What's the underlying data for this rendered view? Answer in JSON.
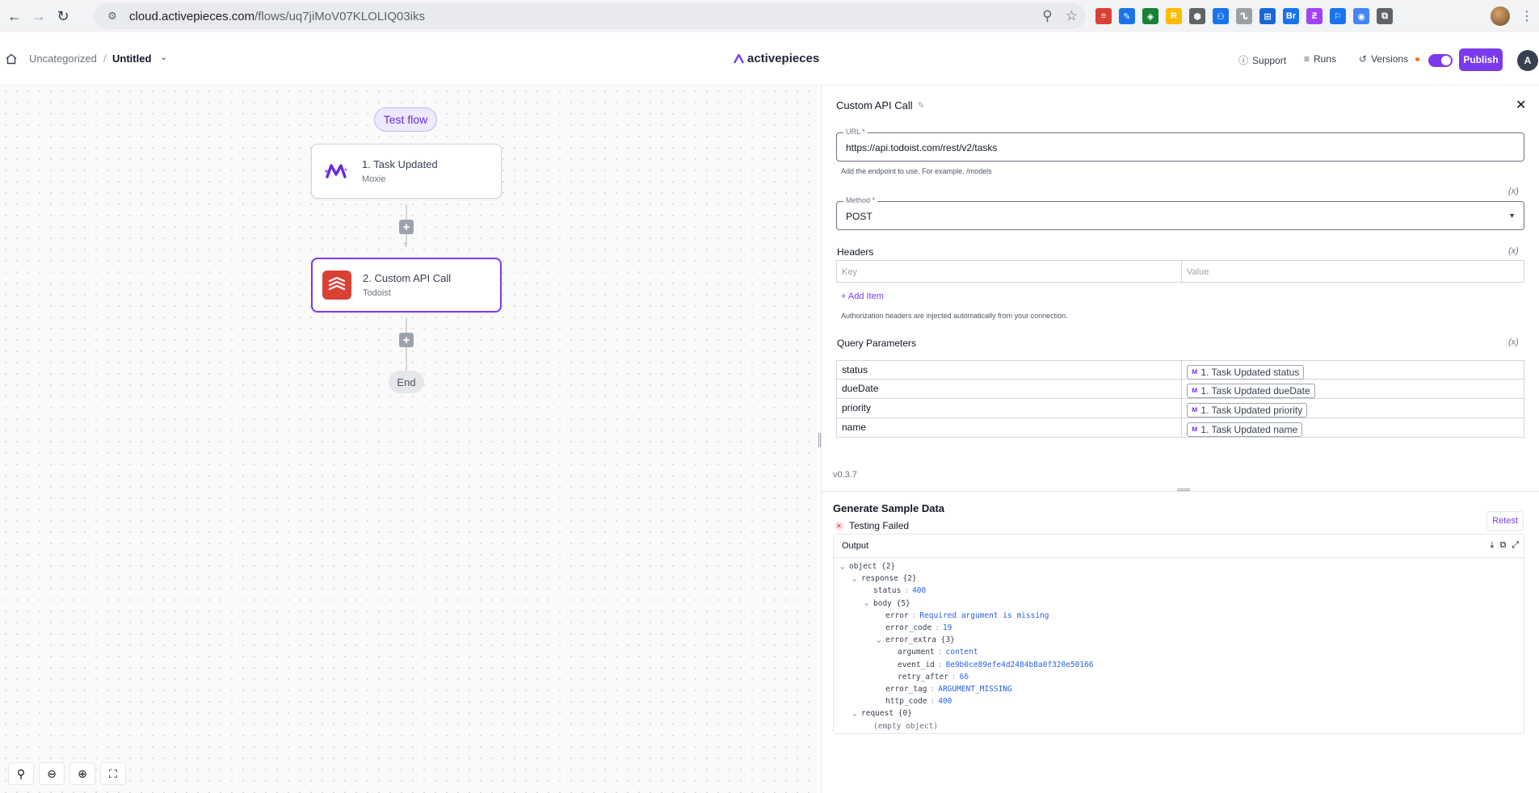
{
  "browser": {
    "url_host": "cloud.activepieces.com",
    "url_path": "/flows/uq7jiMoV07KLOLIQ03iks",
    "extensions": [
      {
        "name": "todoist-ext-icon",
        "color": "#db4035",
        "glyph": "≡"
      },
      {
        "name": "pen-ext-icon",
        "color": "#1a73e8",
        "glyph": "✎"
      },
      {
        "name": "layers-ext-icon",
        "color": "#188038",
        "glyph": "◈"
      },
      {
        "name": "r-ext-icon",
        "color": "#fbbc04",
        "glyph": "R"
      },
      {
        "name": "shield-ext-icon",
        "color": "#5f6368",
        "glyph": "⬢"
      },
      {
        "name": "link-ext-icon",
        "color": "#1a73e8",
        "glyph": "⚇"
      },
      {
        "name": "wave-ext-icon",
        "color": "#9aa0a6",
        "glyph": "ᔐ"
      },
      {
        "name": "grid-ext-icon",
        "color": "#1967d2",
        "glyph": "⊞"
      },
      {
        "name": "br-ext-icon",
        "color": "#1a73e8",
        "glyph": "Br"
      },
      {
        "name": "make-ext-icon",
        "color": "#a142f4",
        "glyph": "Ƶ"
      },
      {
        "name": "bookmark-ext-icon",
        "color": "#1a73e8",
        "glyph": "⚐"
      },
      {
        "name": "circle-ext-icon",
        "color": "#4285f4",
        "glyph": "◉"
      },
      {
        "name": "puzzle-ext-icon",
        "color": "#5f6368",
        "glyph": "⧉"
      }
    ]
  },
  "header": {
    "folder": "Uncategorized",
    "separator": "/",
    "flow_name": "Untitled",
    "logo_text": "activepieces",
    "support": "Support",
    "runs": "Runs",
    "versions": "Versions",
    "publish": "Publish",
    "avatar": "A"
  },
  "canvas": {
    "test_flow": "Test flow",
    "steps": [
      {
        "title": "1. Task Updated",
        "subtitle": "Moxie"
      },
      {
        "title": "2. Custom API Call",
        "subtitle": "Todoist"
      }
    ],
    "end": "End",
    "add_glyph": "+"
  },
  "panel": {
    "title": "Custom API Call",
    "url": {
      "legend": "URL *",
      "value": "https://api.todoist.com/rest/v2/tasks",
      "helper": "Add the endpoint to use. For example, /models"
    },
    "fx": "(x)",
    "method": {
      "legend": "Method *",
      "value": "POST"
    },
    "headers": {
      "label": "Headers",
      "key_placeholder": "Key",
      "value_placeholder": "Value",
      "add_item": "+ Add Item",
      "helper": "Authorization headers are injected automatically from your connection."
    },
    "query": {
      "label": "Query Parameters",
      "rows": [
        {
          "key": "status",
          "value": "1. Task Updated status"
        },
        {
          "key": "dueDate",
          "value": "1. Task Updated dueDate"
        },
        {
          "key": "priority",
          "value": "1. Task Updated priority"
        },
        {
          "key": "name",
          "value": "1. Task Updated name"
        }
      ]
    },
    "version": "v0.3.7",
    "sample": {
      "title": "Generate Sample Data",
      "status": "Testing Failed",
      "retest": "Retest",
      "output_label": "Output",
      "tree": [
        {
          "depth": 0,
          "toggle": "⌄",
          "key": "object {2}"
        },
        {
          "depth": 1,
          "toggle": "⌄",
          "key": "response {2}"
        },
        {
          "depth": 2,
          "toggle": "",
          "key": "status",
          "value": "400"
        },
        {
          "depth": 2,
          "toggle": "⌄",
          "key": "body {5}"
        },
        {
          "depth": 3,
          "toggle": "",
          "key": "error",
          "value": "Required argument is missing"
        },
        {
          "depth": 3,
          "toggle": "",
          "key": "error_code",
          "value": "19"
        },
        {
          "depth": 3,
          "toggle": "⌄",
          "key": "error_extra {3}"
        },
        {
          "depth": 4,
          "toggle": "",
          "key": "argument",
          "value": "content"
        },
        {
          "depth": 4,
          "toggle": "",
          "key": "event_id",
          "value": "8e9b0ce89efe4d2484b8a0f320e50166"
        },
        {
          "depth": 4,
          "toggle": "",
          "key": "retry_after",
          "value": "66"
        },
        {
          "depth": 3,
          "toggle": "",
          "key": "error_tag",
          "value": "ARGUMENT_MISSING"
        },
        {
          "depth": 3,
          "toggle": "",
          "key": "http_code",
          "value": "400"
        },
        {
          "depth": 1,
          "toggle": "⌄",
          "key": "request {0}"
        },
        {
          "depth": 2,
          "toggle": "",
          "key": "(empty object)",
          "empty": true
        }
      ]
    }
  },
  "colors": {
    "accent": "#7c3aed",
    "todoist": "#db4035"
  }
}
